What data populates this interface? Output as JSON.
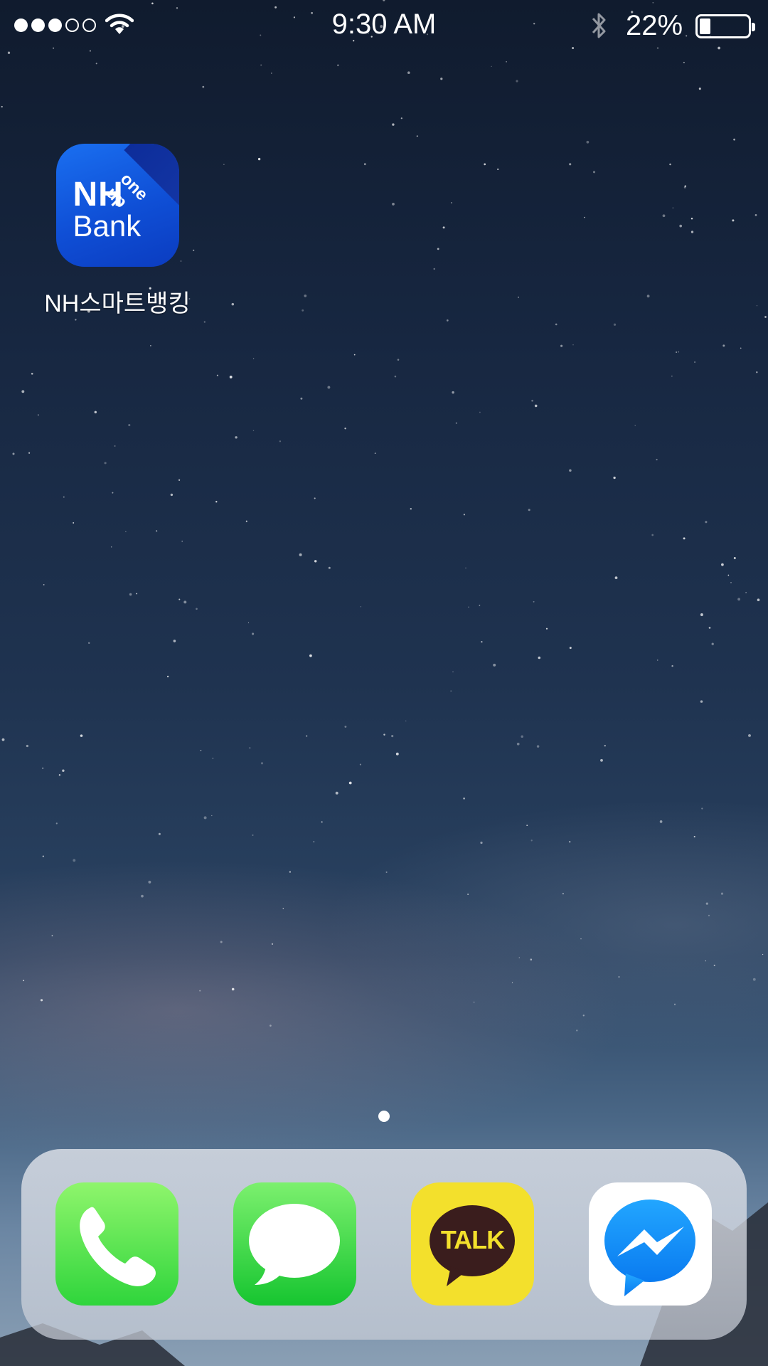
{
  "status_bar": {
    "time": "9:30 AM",
    "battery_percent_label": "22%",
    "battery_level": 0.22,
    "signal_bars_filled": 3,
    "signal_bars_total": 5,
    "wifi_icon": "wifi-icon",
    "bluetooth_icon": "bluetooth-icon"
  },
  "home": {
    "apps": [
      {
        "label": "NH스마트뱅킹",
        "icon": "nh-bank-icon",
        "icon_text_main": "NH",
        "icon_text_sub": "Bank",
        "icon_text_corner": "one up",
        "color": "#1467e8"
      }
    ],
    "page_count": 1,
    "current_page": 1
  },
  "dock": {
    "apps": [
      {
        "name": "Phone",
        "icon": "phone-icon",
        "color": "#34d840"
      },
      {
        "name": "Messages",
        "icon": "messages-icon",
        "color": "#22c93a"
      },
      {
        "name": "KakaoTalk",
        "icon": "kakaotalk-icon",
        "icon_text": "TALK",
        "color": "#f3e02c"
      },
      {
        "name": "Messenger",
        "icon": "messenger-icon",
        "color": "#1a8cff"
      }
    ]
  },
  "wallpaper": {
    "top_color": "#101b2e",
    "bottom_color": "#8a9fb4"
  }
}
